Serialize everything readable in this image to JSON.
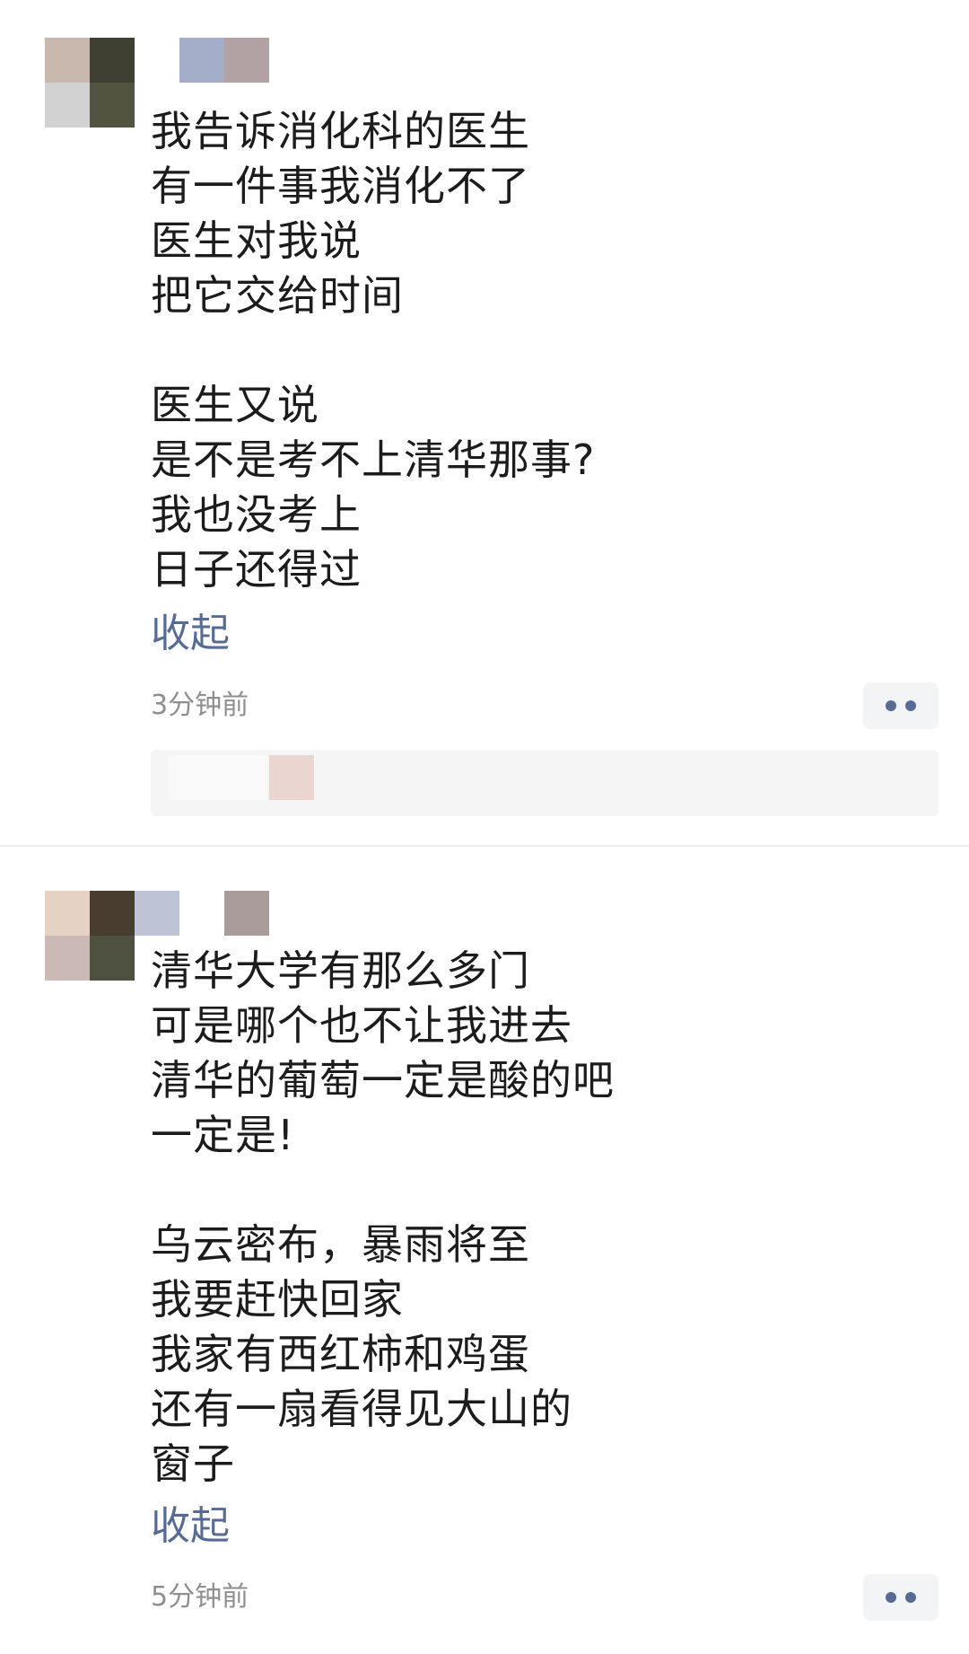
{
  "posts": [
    {
      "lines": [
        "我告诉消化科的医生",
        "有一件事我消化不了",
        "医生对我说",
        "把它交给时间"
      ],
      "lines2": [
        "医生又说",
        "是不是考不上清华那事?",
        "我也没考上",
        "日子还得过"
      ],
      "collapse_label": "收起",
      "time": "3分钟前"
    },
    {
      "lines": [
        "清华大学有那么多门",
        "可是哪个也不让我进去",
        "清华的葡萄一定是酸的吧",
        "一定是!"
      ],
      "lines2": [
        "乌云密布，暴雨将至",
        "我要赶快回家",
        "我家有西红柿和鸡蛋",
        "还有一扇看得见大山的",
        "窗子"
      ],
      "collapse_label": "收起",
      "time": "5分钟前"
    }
  ],
  "icons": {
    "more": "more-dots-icon"
  },
  "colors": {
    "link": "#576b95",
    "time": "#8f8f8f",
    "divider": "#ececec"
  }
}
